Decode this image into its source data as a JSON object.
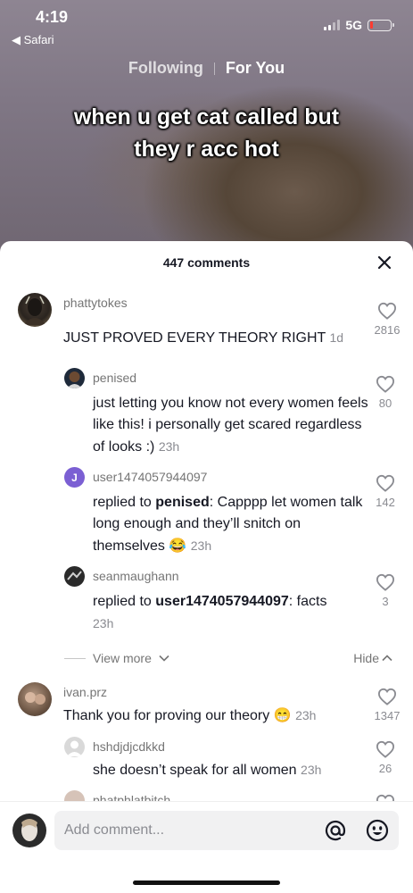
{
  "status_bar": {
    "time": "4:19",
    "back_label": "◀ Safari",
    "network": "5G",
    "battery_color": "#ff3b30"
  },
  "feed_tabs": {
    "following": "Following",
    "for_you": "For You"
  },
  "video": {
    "caption_line1": "when u get cat called but",
    "caption_line2": "they r acc hot"
  },
  "comments_panel": {
    "title": "447 comments",
    "view_more": "View more",
    "hide": "Hide",
    "comments": [
      {
        "username": "phattytokes",
        "text": "JUST PROVED EVERY THEORY RIGHT",
        "time": "1d",
        "likes": "2816"
      },
      {
        "username": "penised",
        "text": "just letting you know not every women feels like this! i personally get scared regardless of looks :)",
        "time": "23h",
        "likes": "80"
      },
      {
        "username": "user1474057944097",
        "avatar_letter": "J",
        "reply_prefix": "replied to",
        "reply_to": "penised",
        "text": ": Capppp let women talk long enough and they’ll snitch on themselves 😂",
        "time": "23h",
        "likes": "142"
      },
      {
        "username": "seanmaughann",
        "reply_prefix": "replied to",
        "reply_to": "user1474057944097",
        "text": ": facts",
        "time": "23h",
        "likes": "3"
      },
      {
        "username": "ivan.prz",
        "text": "Thank you for proving our theory 😁",
        "time": "23h",
        "likes": "1347"
      },
      {
        "username": "hshdjdjcdkkd",
        "text": "she doesn’t speak for all women",
        "time": "23h",
        "likes": "26"
      },
      {
        "username": "phatphlatbitch"
      }
    ]
  },
  "composer": {
    "placeholder": "Add comment..."
  },
  "colors": {
    "accent_purple": "#7b5fd3",
    "text_primary": "#161823",
    "text_secondary": "#757575"
  }
}
